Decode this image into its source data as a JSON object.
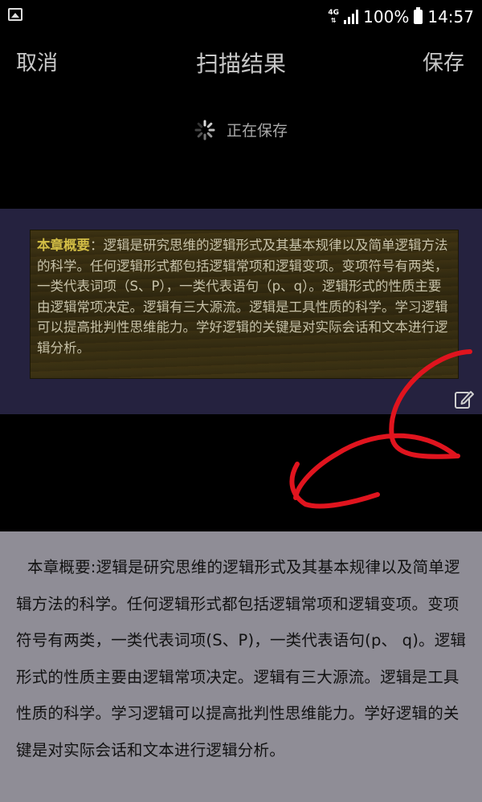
{
  "status_bar": {
    "network": "4G",
    "battery": "100%",
    "time": "14:57"
  },
  "toolbar": {
    "cancel_label": "取消",
    "title": "扫描结果",
    "save_label": "保存"
  },
  "saving_status": "正在保存",
  "scanned_image": {
    "heading": "本章概要",
    "separator": "：",
    "body": "逻辑是研究思维的逻辑形式及其基本规律以及简单逻辑方法的科学。任何逻辑形式都包括逻辑常项和逻辑变项。变项符号有两类，一类代表词项（S、P），一类代表语句（p、q）。逻辑形式的性质主要由逻辑常项决定。逻辑有三大源流。逻辑是工具性质的科学。学习逻辑可以提高批判性思维能力。学好逻辑的关键是对实际会话和文本进行逻辑分析。"
  },
  "result_text": "本章概要:逻辑是研究思维的逻辑形式及其基本规律以及简单逻辑方法的科学。任何逻辑形式都包括逻辑常项和逻辑变项。变项符号有两类，一类代表词项(S、P)，一类代表语句(p、 q)。逻辑形式的性质主要由逻辑常项决定。逻辑有三大源流。逻辑是工具性质的科学。学习逻辑可以提高批判性思维能力。学好逻辑的关键是对实际会话和文本进行逻辑分析。",
  "icons": {
    "status_left": "image-icon",
    "edit": "edit-icon",
    "spinner": "loading-spinner-icon"
  },
  "colors": {
    "annotation": "#e0141e",
    "heading_highlight": "#d2bd45"
  }
}
